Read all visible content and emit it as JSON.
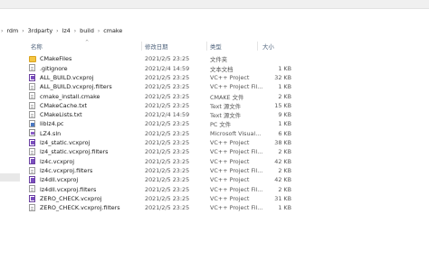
{
  "breadcrumb": {
    "items": [
      "rdm",
      "3rdparty",
      "lz4",
      "build",
      "cmake"
    ],
    "separator": "›"
  },
  "columns": {
    "name": "名称",
    "date": "修改日期",
    "type": "类型",
    "size": "大小"
  },
  "files": [
    {
      "name": "CMakeFiles",
      "date": "2021/2/5 23:25",
      "type": "文件夹",
      "size": "",
      "icon": "folder-icon"
    },
    {
      "name": ".gitignore",
      "date": "2021/2/4 14:59",
      "type": "文本文档",
      "size": "1 KB",
      "icon": "text-file-icon"
    },
    {
      "name": "ALL_BUILD.vcxproj",
      "date": "2021/2/5 23:25",
      "type": "VC++ Project",
      "size": "32 KB",
      "icon": "vcxproj-icon"
    },
    {
      "name": "ALL_BUILD.vcxproj.filters",
      "date": "2021/2/5 23:25",
      "type": "VC++ Project Fil...",
      "size": "1 KB",
      "icon": "vcxproj-filters-icon"
    },
    {
      "name": "cmake_install.cmake",
      "date": "2021/2/5 23:25",
      "type": "CMAKE 文件",
      "size": "2 KB",
      "icon": "cmake-file-icon"
    },
    {
      "name": "CMakeCache.txt",
      "date": "2021/2/5 23:25",
      "type": "Text 源文件",
      "size": "15 KB",
      "icon": "text-file-icon"
    },
    {
      "name": "CMakeLists.txt",
      "date": "2021/2/4 14:59",
      "type": "Text 源文件",
      "size": "9 KB",
      "icon": "text-file-icon"
    },
    {
      "name": "liblz4.pc",
      "date": "2021/2/5 23:25",
      "type": "PC 文件",
      "size": "1 KB",
      "icon": "pc-file-icon"
    },
    {
      "name": "LZ4.sln",
      "date": "2021/2/5 23:25",
      "type": "Microsoft Visual...",
      "size": "6 KB",
      "icon": "sln-icon"
    },
    {
      "name": "lz4_static.vcxproj",
      "date": "2021/2/5 23:25",
      "type": "VC++ Project",
      "size": "38 KB",
      "icon": "vcxproj-icon"
    },
    {
      "name": "lz4_static.vcxproj.filters",
      "date": "2021/2/5 23:25",
      "type": "VC++ Project Fil...",
      "size": "2 KB",
      "icon": "vcxproj-filters-icon"
    },
    {
      "name": "lz4c.vcxproj",
      "date": "2021/2/5 23:25",
      "type": "VC++ Project",
      "size": "42 KB",
      "icon": "vcxproj-icon"
    },
    {
      "name": "lz4c.vcxproj.filters",
      "date": "2021/2/5 23:25",
      "type": "VC++ Project Fil...",
      "size": "2 KB",
      "icon": "vcxproj-filters-icon"
    },
    {
      "name": "lz4dll.vcxproj",
      "date": "2021/2/5 23:25",
      "type": "VC++ Project",
      "size": "42 KB",
      "icon": "vcxproj-icon"
    },
    {
      "name": "lz4dll.vcxproj.filters",
      "date": "2021/2/5 23:25",
      "type": "VC++ Project Fil...",
      "size": "2 KB",
      "icon": "vcxproj-filters-icon"
    },
    {
      "name": "ZERO_CHECK.vcxproj",
      "date": "2021/2/5 23:25",
      "type": "VC++ Project",
      "size": "31 KB",
      "icon": "vcxproj-icon"
    },
    {
      "name": "ZERO_CHECK.vcxproj.filters",
      "date": "2021/2/5 23:25",
      "type": "VC++ Project Fil...",
      "size": "1 KB",
      "icon": "vcxproj-filters-icon"
    }
  ]
}
